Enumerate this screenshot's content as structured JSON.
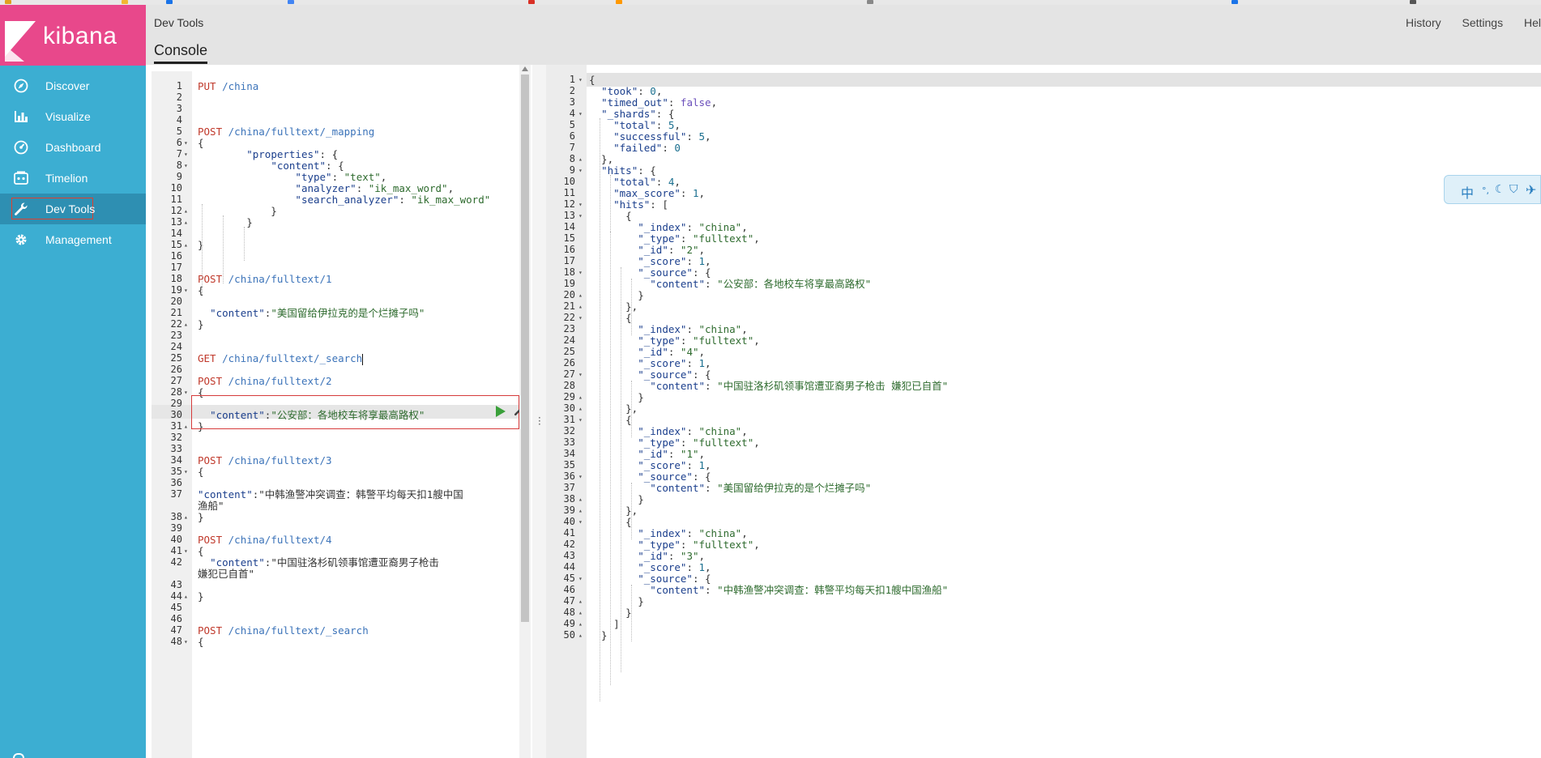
{
  "app": {
    "logo_text": "kibana",
    "header_title": "Dev Tools",
    "tab_label": "Console",
    "header_links": [
      "History",
      "Settings",
      "Hel"
    ]
  },
  "sidebar": {
    "items": [
      {
        "label": "Discover",
        "icon": "compass-icon"
      },
      {
        "label": "Visualize",
        "icon": "bar-chart-icon"
      },
      {
        "label": "Dashboard",
        "icon": "dashboard-icon"
      },
      {
        "label": "Timelion",
        "icon": "timelion-icon"
      },
      {
        "label": "Dev Tools",
        "icon": "wrench-icon",
        "active": true
      },
      {
        "label": "Management",
        "icon": "gear-icon"
      }
    ]
  },
  "editor": {
    "lines": [
      {
        "n": 1,
        "t": "PUT /china",
        "c": "req"
      },
      {
        "n": 2,
        "t": ""
      },
      {
        "n": 3,
        "t": ""
      },
      {
        "n": 4,
        "t": ""
      },
      {
        "n": 5,
        "t": "POST /china/fulltext/_mapping",
        "c": "req"
      },
      {
        "n": 6,
        "t": "{",
        "f": "▾"
      },
      {
        "n": 7,
        "t": "        \"properties\": {",
        "f": "▾"
      },
      {
        "n": 8,
        "t": "            \"content\": {",
        "f": "▾"
      },
      {
        "n": 9,
        "t": "                \"type\": \"text\","
      },
      {
        "n": 10,
        "t": "                \"analyzer\": \"ik_max_word\","
      },
      {
        "n": 11,
        "t": "                \"search_analyzer\": \"ik_max_word\""
      },
      {
        "n": 12,
        "t": "            }",
        "f": "▴"
      },
      {
        "n": 13,
        "t": "        }",
        "f": "▴"
      },
      {
        "n": 14,
        "t": ""
      },
      {
        "n": 15,
        "t": "}",
        "f": "▴"
      },
      {
        "n": 16,
        "t": ""
      },
      {
        "n": 17,
        "t": ""
      },
      {
        "n": 18,
        "t": "POST /china/fulltext/1",
        "c": "req"
      },
      {
        "n": 19,
        "t": "{",
        "f": "▾"
      },
      {
        "n": 20,
        "t": ""
      },
      {
        "n": 21,
        "t": "  \"content\":\"美国留给伊拉克的是个烂摊子吗\""
      },
      {
        "n": 22,
        "t": "}",
        "f": "▴"
      },
      {
        "n": 23,
        "t": ""
      },
      {
        "n": 24,
        "t": ""
      },
      {
        "n": 25,
        "t": "GET /china/fulltext/_search",
        "c": "req",
        "sel": true
      },
      {
        "n": 26,
        "t": ""
      },
      {
        "n": 27,
        "t": "POST /china/fulltext/2",
        "c": "req"
      },
      {
        "n": 28,
        "t": "{",
        "f": "▾"
      },
      {
        "n": 29,
        "t": ""
      },
      {
        "n": 30,
        "t": "  \"content\":\"公安部：各地校车将享最高路权\""
      },
      {
        "n": 31,
        "t": "}",
        "f": "▴"
      },
      {
        "n": 32,
        "t": ""
      },
      {
        "n": 33,
        "t": ""
      },
      {
        "n": 34,
        "t": "POST /china/fulltext/3",
        "c": "req"
      },
      {
        "n": 35,
        "t": "{",
        "f": "▾"
      },
      {
        "n": 36,
        "t": ""
      },
      {
        "n": 37,
        "t": "\"content\":\"中韩渔警冲突调查：韩警平均每天扣1艘中国"
      },
      {
        "n": "",
        "t": "渔船\""
      },
      {
        "n": 38,
        "t": "}",
        "f": "▴"
      },
      {
        "n": 39,
        "t": ""
      },
      {
        "n": 40,
        "t": "POST /china/fulltext/4",
        "c": "req"
      },
      {
        "n": 41,
        "t": "{",
        "f": "▾"
      },
      {
        "n": 42,
        "t": "  \"content\":\"中国驻洛杉矶领事馆遭亚裔男子枪击"
      },
      {
        "n": "",
        "t": "嫌犯已自首\""
      },
      {
        "n": 43,
        "t": ""
      },
      {
        "n": 44,
        "t": "}",
        "f": "▴"
      },
      {
        "n": 45,
        "t": ""
      },
      {
        "n": 46,
        "t": ""
      },
      {
        "n": 47,
        "t": "POST /china/fulltext/_search",
        "c": "req"
      },
      {
        "n": 48,
        "t": "{",
        "f": "▾"
      }
    ]
  },
  "output": {
    "lines": [
      {
        "n": 1,
        "t": "{",
        "f": "▾"
      },
      {
        "n": 2,
        "t": "  \"took\": 0,"
      },
      {
        "n": 3,
        "t": "  \"timed_out\": false,"
      },
      {
        "n": 4,
        "t": "  \"_shards\": {",
        "f": "▾"
      },
      {
        "n": 5,
        "t": "    \"total\": 5,"
      },
      {
        "n": 6,
        "t": "    \"successful\": 5,"
      },
      {
        "n": 7,
        "t": "    \"failed\": 0"
      },
      {
        "n": 8,
        "t": "  },",
        "f": "▴"
      },
      {
        "n": 9,
        "t": "  \"hits\": {",
        "f": "▾"
      },
      {
        "n": 10,
        "t": "    \"total\": 4,"
      },
      {
        "n": 11,
        "t": "    \"max_score\": 1,"
      },
      {
        "n": 12,
        "t": "    \"hits\": [",
        "f": "▾"
      },
      {
        "n": 13,
        "t": "      {",
        "f": "▾"
      },
      {
        "n": 14,
        "t": "        \"_index\": \"china\","
      },
      {
        "n": 15,
        "t": "        \"_type\": \"fulltext\","
      },
      {
        "n": 16,
        "t": "        \"_id\": \"2\","
      },
      {
        "n": 17,
        "t": "        \"_score\": 1,"
      },
      {
        "n": 18,
        "t": "        \"_source\": {",
        "f": "▾"
      },
      {
        "n": 19,
        "t": "          \"content\": \"公安部：各地校车将享最高路权\""
      },
      {
        "n": 20,
        "t": "        }",
        "f": "▴"
      },
      {
        "n": 21,
        "t": "      },",
        "f": "▴"
      },
      {
        "n": 22,
        "t": "      {",
        "f": "▾"
      },
      {
        "n": 23,
        "t": "        \"_index\": \"china\","
      },
      {
        "n": 24,
        "t": "        \"_type\": \"fulltext\","
      },
      {
        "n": 25,
        "t": "        \"_id\": \"4\","
      },
      {
        "n": 26,
        "t": "        \"_score\": 1,"
      },
      {
        "n": 27,
        "t": "        \"_source\": {",
        "f": "▾"
      },
      {
        "n": 28,
        "t": "          \"content\": \"中国驻洛杉矶领事馆遭亚裔男子枪击 嫌犯已自首\""
      },
      {
        "n": 29,
        "t": "        }",
        "f": "▴"
      },
      {
        "n": 30,
        "t": "      },",
        "f": "▴"
      },
      {
        "n": 31,
        "t": "      {",
        "f": "▾"
      },
      {
        "n": 32,
        "t": "        \"_index\": \"china\","
      },
      {
        "n": 33,
        "t": "        \"_type\": \"fulltext\","
      },
      {
        "n": 34,
        "t": "        \"_id\": \"1\","
      },
      {
        "n": 35,
        "t": "        \"_score\": 1,"
      },
      {
        "n": 36,
        "t": "        \"_source\": {",
        "f": "▾"
      },
      {
        "n": 37,
        "t": "          \"content\": \"美国留给伊拉克的是个烂摊子吗\""
      },
      {
        "n": 38,
        "t": "        }",
        "f": "▴"
      },
      {
        "n": 39,
        "t": "      },",
        "f": "▴"
      },
      {
        "n": 40,
        "t": "      {",
        "f": "▾"
      },
      {
        "n": 41,
        "t": "        \"_index\": \"china\","
      },
      {
        "n": 42,
        "t": "        \"_type\": \"fulltext\","
      },
      {
        "n": 43,
        "t": "        \"_id\": \"3\","
      },
      {
        "n": 44,
        "t": "        \"_score\": 1,"
      },
      {
        "n": 45,
        "t": "        \"_source\": {",
        "f": "▾"
      },
      {
        "n": 46,
        "t": "          \"content\": \"中韩渔警冲突调查：韩警平均每天扣1艘中国渔船\""
      },
      {
        "n": 47,
        "t": "        }",
        "f": "▴"
      },
      {
        "n": 48,
        "t": "      }",
        "f": "▴"
      },
      {
        "n": 49,
        "t": "    ]",
        "f": "▴"
      },
      {
        "n": 50,
        "t": "  }",
        "f": "▴"
      }
    ]
  },
  "ime": {
    "label": "中"
  },
  "colors": {
    "sidebar": "#3caed2",
    "logo_bg": "#e8488b",
    "active_item": "#2e8fb2",
    "method": "#c0392b",
    "url": "#3b73b9"
  }
}
